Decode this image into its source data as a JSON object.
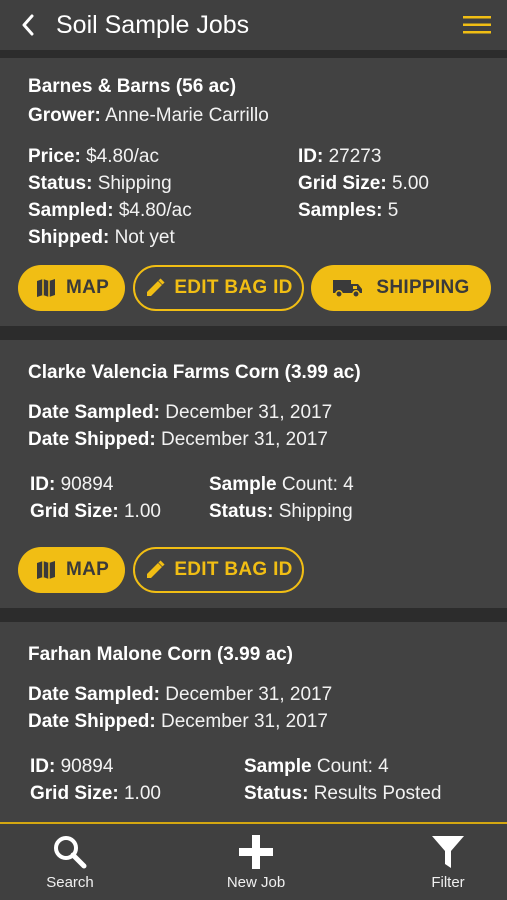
{
  "header": {
    "title": "Soil Sample Jobs",
    "back_icon": "chevron-left-icon",
    "menu_icon": "hamburger-menu-icon",
    "menu_color": "#f1be14"
  },
  "accent_color": "#f1be14",
  "jobs": [
    {
      "title": "Barnes & Barns  (56 ac)",
      "grower_label": "Grower:",
      "grower_value": "Anne-Marie Carrillo",
      "price_label": "Price:",
      "price_value": "$4.80/ac",
      "status_label": "Status:",
      "status_value": "Shipping",
      "sampled_label": "Sampled:",
      "sampled_value": "$4.80/ac",
      "shipped_label": "Shipped:",
      "shipped_value": "Not yet",
      "id_label": "ID:",
      "id_value": "27273",
      "grid_label": "Grid Size:",
      "grid_value": "5.00",
      "samples_label": "Samples:",
      "samples_value": "5",
      "map_label": "MAP",
      "edit_label": "EDIT BAG ID",
      "shipping_label": "SHIPPING"
    },
    {
      "title": "Clarke Valencia Farms  Corn (3.99 ac)",
      "date_sampled_label": "Date Sampled:",
      "date_sampled_value": "December 31, 2017",
      "date_shipped_label": "Date Shipped:",
      "date_shipped_value": "December 31, 2017",
      "id_label": "ID:",
      "id_value": "90894",
      "grid_label": "Grid Size:",
      "grid_value": "1.00",
      "sample_label": "Sample",
      "count_text": "Count: 4",
      "status_label": "Status:",
      "status_value": "Shipping",
      "map_label": "MAP",
      "edit_label": "EDIT BAG ID"
    },
    {
      "title": "Farhan Malone Corn (3.99 ac)",
      "date_sampled_label": "Date Sampled:",
      "date_sampled_value": "December 31, 2017",
      "date_shipped_label": "Date Shipped:",
      "date_shipped_value": "December 31, 2017",
      "id_label": "ID:",
      "id_value": "90894",
      "grid_label": "Grid Size:",
      "grid_value": "1.00",
      "sample_label": "Sample",
      "count_text": "Count: 4",
      "status_label": "Status:",
      "status_value": "Results Posted"
    }
  ],
  "bottom_nav": {
    "search_label": "Search",
    "new_job_label": "New Job",
    "filter_label": "Filter"
  }
}
